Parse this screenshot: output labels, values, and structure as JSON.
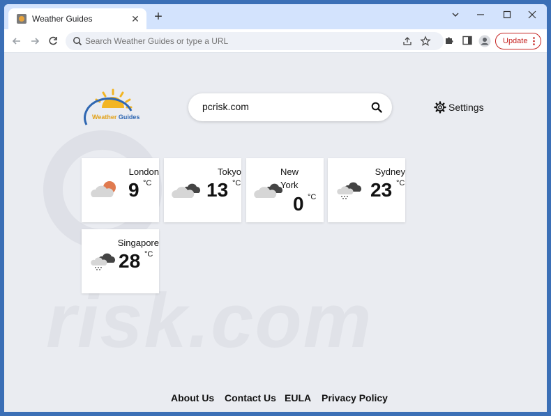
{
  "browser": {
    "tab_title": "Weather Guides",
    "omnibox_placeholder": "Search Weather Guides or type a URL",
    "update_label": "Update"
  },
  "logo": {
    "part1": "Weather",
    "part2": " Guides"
  },
  "search": {
    "value": "pcrisk.com"
  },
  "settings": {
    "label": "Settings"
  },
  "watermark": "risk.com",
  "cards": [
    {
      "city": "London",
      "temp": "9",
      "unit": "°C",
      "icon": "partly-cloudy-icon"
    },
    {
      "city": "Tokyo",
      "temp": "13",
      "unit": "°C",
      "icon": "cloudy-icon"
    },
    {
      "city": "New York",
      "temp": "0",
      "unit": "°C",
      "icon": "cloudy-icon"
    },
    {
      "city": "Sydney",
      "temp": "23",
      "unit": "°C",
      "icon": "rain-icon"
    },
    {
      "city": "Singapore",
      "temp": "28",
      "unit": "°C",
      "icon": "rain-icon"
    }
  ],
  "footer": {
    "about": "About Us",
    "contact": "Contact Us",
    "eula": "EULA",
    "privacy": "Privacy Policy"
  },
  "colors": {
    "accent_red": "#c5221f",
    "logo_orange": "#e2a118",
    "logo_blue": "#2f67b2"
  }
}
